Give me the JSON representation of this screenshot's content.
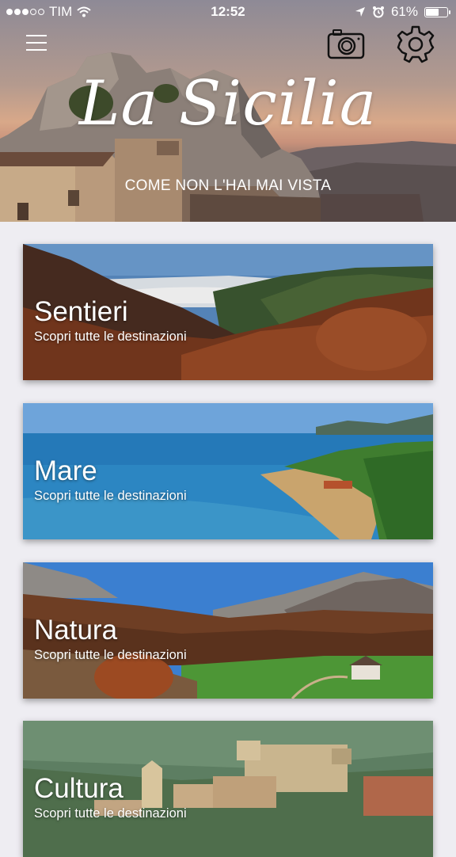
{
  "status_bar": {
    "carrier": "TIM",
    "time": "12:52",
    "battery": "61%",
    "signal_bars_filled": 3,
    "signal_bars_total": 5
  },
  "header": {
    "title": "La Sicilia",
    "subtitle": "COME NON L'HAI MAI VISTA",
    "icons": [
      "menu-icon",
      "camera-icon",
      "gear-icon"
    ]
  },
  "categories": [
    {
      "title": "Sentieri",
      "subtitle": "Scopri tutte le destinazioni"
    },
    {
      "title": "Mare",
      "subtitle": "Scopri tutte le destinazioni"
    },
    {
      "title": "Natura",
      "subtitle": "Scopri tutte le destinazioni"
    },
    {
      "title": "Cultura",
      "subtitle": "Scopri tutte le destinazioni"
    }
  ]
}
